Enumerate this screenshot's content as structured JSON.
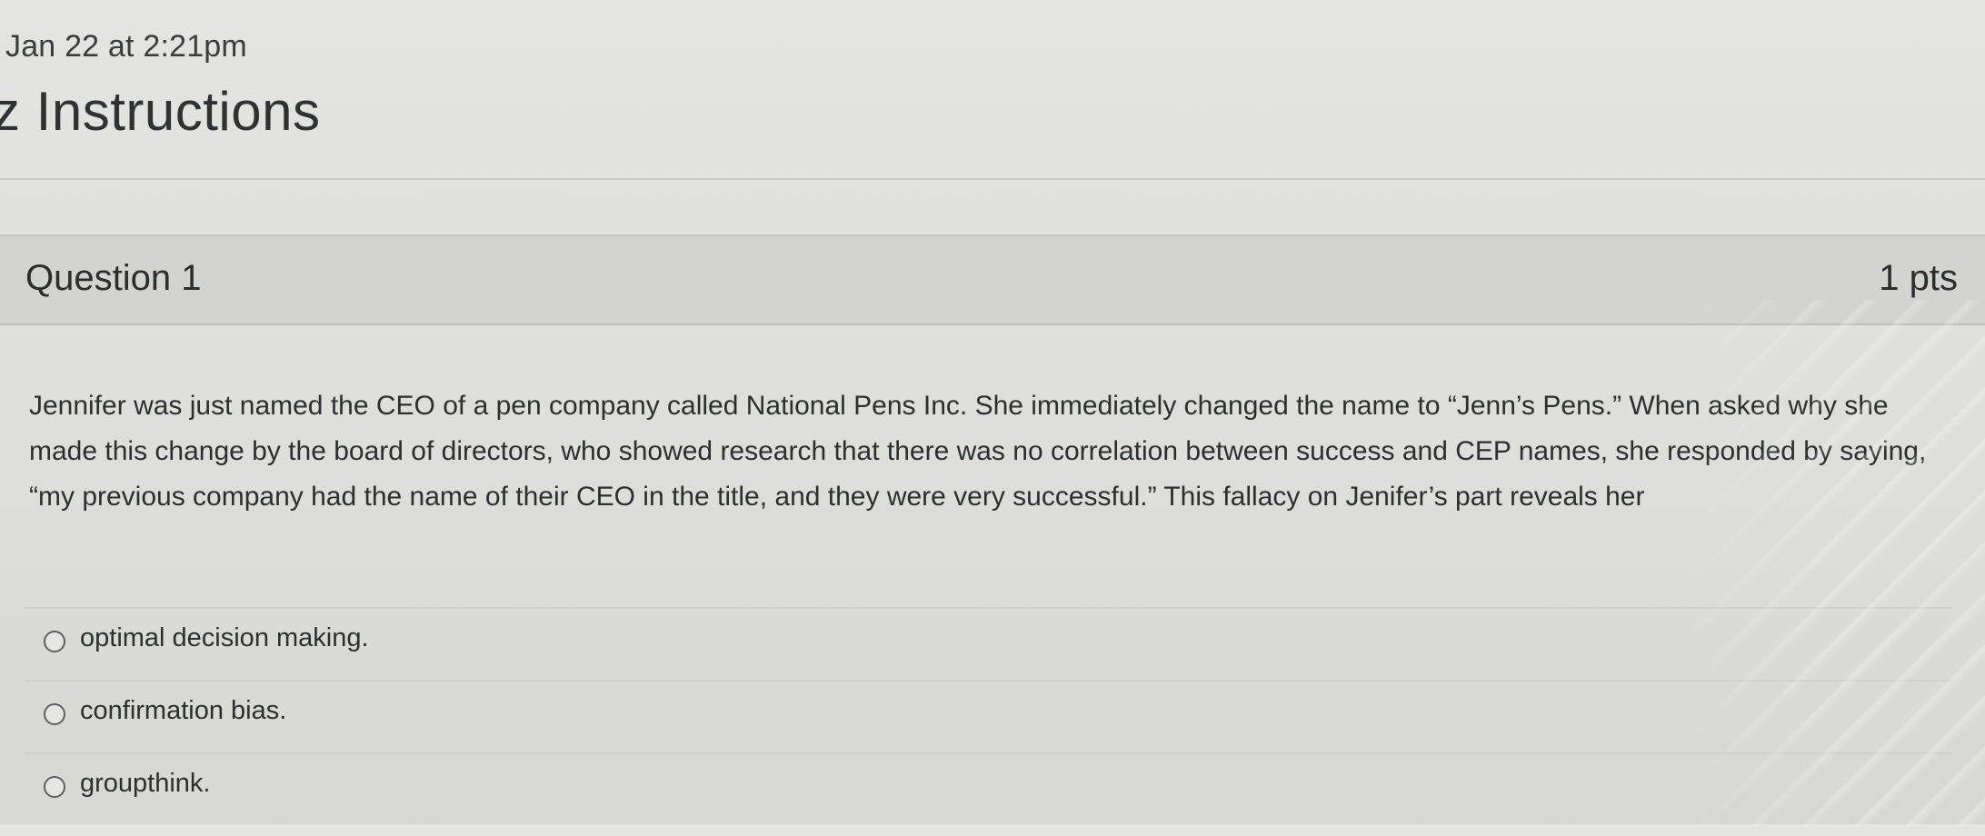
{
  "header": {
    "timestamp": "Jan 22 at 2:21pm",
    "title": "z Instructions"
  },
  "question": {
    "title": "Question 1",
    "points": "1 pts",
    "text": "Jennifer was just named the CEO of a pen company called National Pens Inc. She immediately changed the name to “Jenn’s Pens.” When asked why she made this change by the board of directors, who showed research that there was no correlation between success and CEP names, she responded by saying, “my previous company had the name of their CEO in the title, and they were very successful.” This fallacy on Jenifer’s part reveals her",
    "answers": [
      {
        "label": "optimal decision making."
      },
      {
        "label": "confirmation bias."
      },
      {
        "label": "groupthink."
      }
    ]
  },
  "colors": {
    "background": "#dfdfdc",
    "header_bar": "#d3d3d0",
    "text": "#2f3133"
  }
}
